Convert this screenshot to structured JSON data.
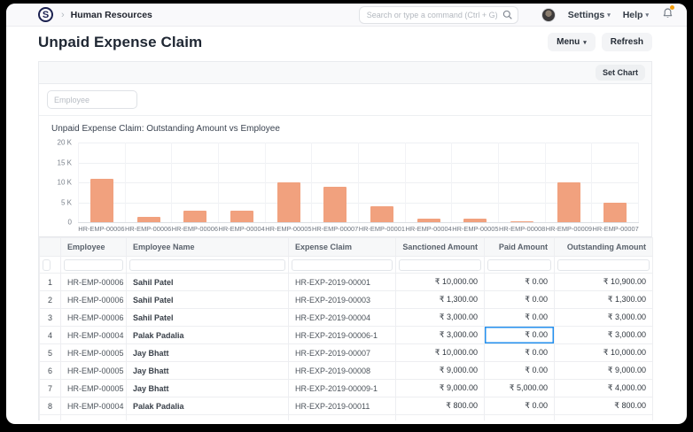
{
  "colors": {
    "accent_blue": "#2490ef",
    "bar": "#f1a17e",
    "notification_dot": "#f59e0b",
    "brand_navy": "#1b2150"
  },
  "icons": {
    "caret_down": "▾",
    "chevron_right": "›"
  },
  "navbar": {
    "logo_letter": "S",
    "breadcrumb": "Human Resources",
    "search_placeholder": "Search or type a command (Ctrl + G)",
    "settings_label": "Settings",
    "help_label": "Help"
  },
  "page": {
    "title": "Unpaid Expense Claim",
    "menu_label": "Menu",
    "refresh_label": "Refresh",
    "set_chart_label": "Set Chart"
  },
  "filters": {
    "employee_placeholder": "Employee"
  },
  "chart_data": {
    "type": "bar",
    "title": "Unpaid Expense Claim: Outstanding Amount vs Employee",
    "categories": [
      "HR-EMP-00006",
      "HR-EMP-00006",
      "HR-EMP-00006",
      "HR-EMP-00004",
      "HR-EMP-00005",
      "HR-EMP-00007",
      "HR-EMP-00001",
      "HR-EMP-00004",
      "HR-EMP-00005",
      "HR-EMP-00008",
      "HR-EMP-00009",
      "HR-EMP-00007"
    ],
    "values": [
      10900,
      1300,
      3000,
      3000,
      10000,
      9000,
      4000,
      800,
      1000,
      150,
      10000,
      5000
    ],
    "xlabel": "",
    "ylabel": "",
    "ylim": [
      0,
      20000
    ],
    "yticks": [
      "20 K",
      "15 K",
      "10 K",
      "5 K",
      "0"
    ],
    "grid": true,
    "legend_position": "none",
    "bar_color": "#f1a17e"
  },
  "table": {
    "columns": [
      "",
      "Employee",
      "Employee Name",
      "Expense Claim",
      "Sanctioned Amount",
      "Paid Amount",
      "Outstanding Amount"
    ],
    "rows": [
      [
        "1",
        "HR-EMP-00006",
        "Sahil Patel",
        "HR-EXP-2019-00001",
        "₹ 10,000.00",
        "₹ 0.00",
        "₹ 10,900.00"
      ],
      [
        "2",
        "HR-EMP-00006",
        "Sahil Patel",
        "HR-EXP-2019-00003",
        "₹ 1,300.00",
        "₹ 0.00",
        "₹ 1,300.00"
      ],
      [
        "3",
        "HR-EMP-00006",
        "Sahil Patel",
        "HR-EXP-2019-00004",
        "₹ 3,000.00",
        "₹ 0.00",
        "₹ 3,000.00"
      ],
      [
        "4",
        "HR-EMP-00004",
        "Palak Padalia",
        "HR-EXP-2019-00006-1",
        "₹ 3,000.00",
        "₹ 0.00",
        "₹ 3,000.00"
      ],
      [
        "5",
        "HR-EMP-00005",
        "Jay Bhatt",
        "HR-EXP-2019-00007",
        "₹ 10,000.00",
        "₹ 0.00",
        "₹ 10,000.00"
      ],
      [
        "6",
        "HR-EMP-00005",
        "Jay Bhatt",
        "HR-EXP-2019-00008",
        "₹ 9,000.00",
        "₹ 0.00",
        "₹ 9,000.00"
      ],
      [
        "7",
        "HR-EMP-00005",
        "Jay Bhatt",
        "HR-EXP-2019-00009-1",
        "₹ 9,000.00",
        "₹ 5,000.00",
        "₹ 4,000.00"
      ],
      [
        "8",
        "HR-EMP-00004",
        "Palak Padalia",
        "HR-EXP-2019-00011",
        "₹ 800.00",
        "₹ 0.00",
        "₹ 800.00"
      ]
    ],
    "selected_cell": {
      "row_number": "4",
      "column": "Paid Amount"
    }
  }
}
